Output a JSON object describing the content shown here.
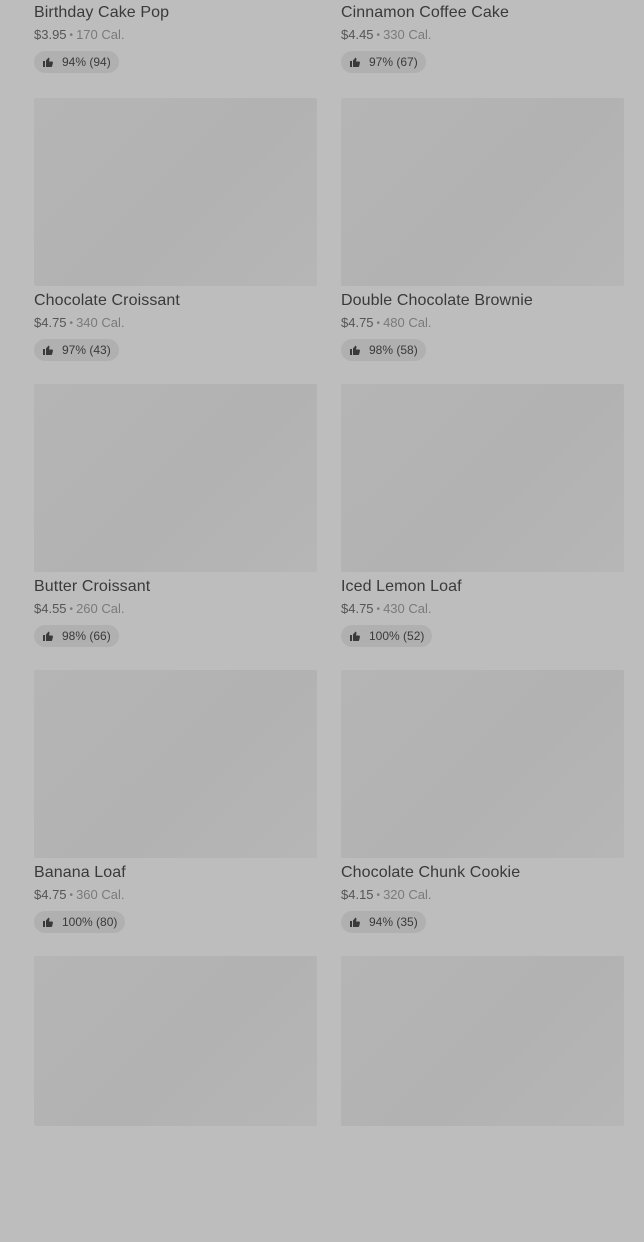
{
  "items": [
    {
      "name": "Birthday Cake Pop",
      "price": "$3.95",
      "calories": "170 Cal.",
      "rating": "94% (94)"
    },
    {
      "name": "Cinnamon Coffee Cake",
      "price": "$4.45",
      "calories": "330 Cal.",
      "rating": "97% (67)"
    },
    {
      "name": "Chocolate Croissant",
      "price": "$4.75",
      "calories": "340 Cal.",
      "rating": "97% (43)"
    },
    {
      "name": "Double Chocolate Brownie",
      "price": "$4.75",
      "calories": "480 Cal.",
      "rating": "98% (58)"
    },
    {
      "name": "Butter Croissant",
      "price": "$4.55",
      "calories": "260 Cal.",
      "rating": "98% (66)"
    },
    {
      "name": "Iced Lemon Loaf",
      "price": "$4.75",
      "calories": "430 Cal.",
      "rating": "100% (52)"
    },
    {
      "name": "Banana Loaf",
      "price": "$4.75",
      "calories": "360 Cal.",
      "rating": "100% (80)"
    },
    {
      "name": "Chocolate Chunk Cookie",
      "price": "$4.15",
      "calories": "320 Cal.",
      "rating": "94% (35)"
    }
  ],
  "separator": "•",
  "rating_icon": "thumbs-up-icon",
  "colors": {
    "background": "#bdbdbd",
    "image_placeholder": "#b4b4b4",
    "rating_pill": "#b0b0b0",
    "text_primary": "#3a3a3a",
    "text_secondary": "#7a7a7a"
  }
}
